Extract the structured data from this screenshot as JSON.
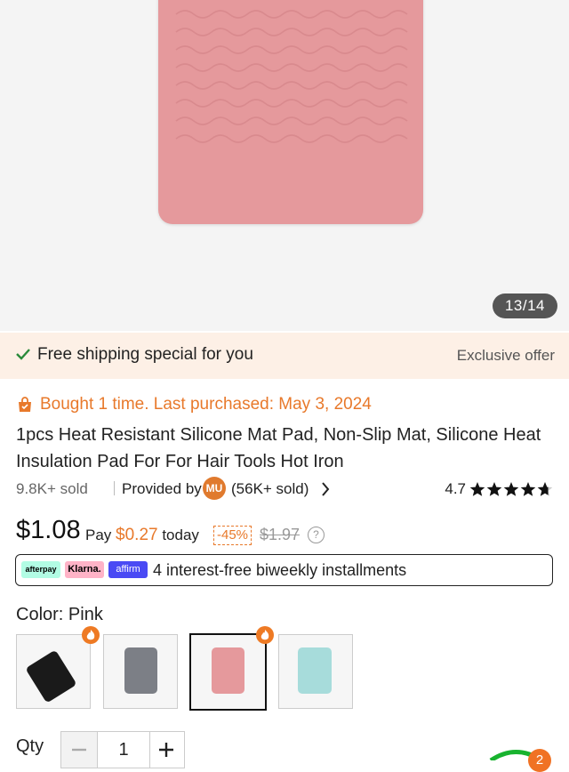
{
  "gallery": {
    "counter": "13/14"
  },
  "shipping_banner": {
    "text": "Free shipping special for you",
    "offer": "Exclusive offer"
  },
  "purchase_history": "Bought 1 time. Last purchased: May 3, 2024",
  "product": {
    "title": "1pcs Heat Resistant Silicone Mat Pad, Non-Slip Mat, Silicone Heat Insulation Pad For For Hair Tools Hot Iron",
    "sold": "9.8K+ sold",
    "provided_by": "Provided by",
    "store_initials": "MU",
    "store_sold": "(56K+ sold)",
    "rating": "4.7",
    "rating_value": 4.7
  },
  "price": {
    "current": "$1.08",
    "pay_prefix": "Pay",
    "pay_amount": "$0.27",
    "pay_suffix": "today",
    "discount": "-45%",
    "original": "$1.97",
    "info_icon": "?"
  },
  "installments": {
    "afterpay": "afterpay",
    "klarna": "Klarna.",
    "affirm": "affirm",
    "text": "4 interest-free biweekly installments"
  },
  "color": {
    "label": "Color: Pink",
    "options": [
      {
        "name": "black",
        "hex": "#1a1a1a",
        "hot": true,
        "selected": false
      },
      {
        "name": "gray",
        "hex": "#7c7f86",
        "hot": false,
        "selected": false
      },
      {
        "name": "pink",
        "hex": "#e5999c",
        "hot": true,
        "selected": true
      },
      {
        "name": "teal",
        "hex": "#a7dcdb",
        "hot": false,
        "selected": false
      }
    ]
  },
  "quantity": {
    "label": "Qty",
    "value": "1"
  },
  "cart_badge": "2",
  "colors": {
    "accent": "#e8792b",
    "shipping_bg": "#fdf0e6",
    "check": "#2a8a3a"
  }
}
